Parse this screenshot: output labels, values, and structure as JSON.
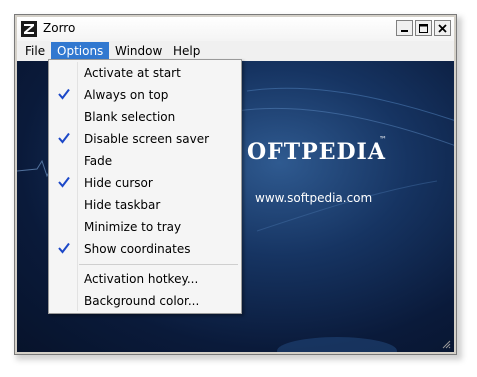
{
  "window": {
    "title": "Zorro",
    "icon": "z-icon",
    "controls": [
      "minimize-icon",
      "maximize-icon",
      "close-icon"
    ]
  },
  "menubar": {
    "items": [
      {
        "label": "File"
      },
      {
        "label": "Options",
        "active": true
      },
      {
        "label": "Window"
      },
      {
        "label": "Help"
      }
    ]
  },
  "options_menu": {
    "items": [
      {
        "label": "Activate at start",
        "checked": false
      },
      {
        "label": "Always on top",
        "checked": true
      },
      {
        "label": "Blank selection",
        "checked": false
      },
      {
        "label": "Disable screen saver",
        "checked": true
      },
      {
        "label": "Fade",
        "checked": false
      },
      {
        "label": "Hide cursor",
        "checked": true
      },
      {
        "label": "Hide taskbar",
        "checked": false
      },
      {
        "label": "Minimize to tray",
        "checked": false
      },
      {
        "label": "Show coordinates",
        "checked": true
      }
    ],
    "extra_items": [
      {
        "label": "Activation hotkey..."
      },
      {
        "label": "Background color..."
      }
    ]
  },
  "background": {
    "logo": "SOFTPEDIA",
    "logo_visible": "OFTPEDIA",
    "trademark": "™",
    "url": "www.softpedia.com"
  },
  "colors": {
    "menu_highlight": "#3178d0",
    "check": "#1c48c8",
    "client_dark": "#0a1a3a"
  }
}
